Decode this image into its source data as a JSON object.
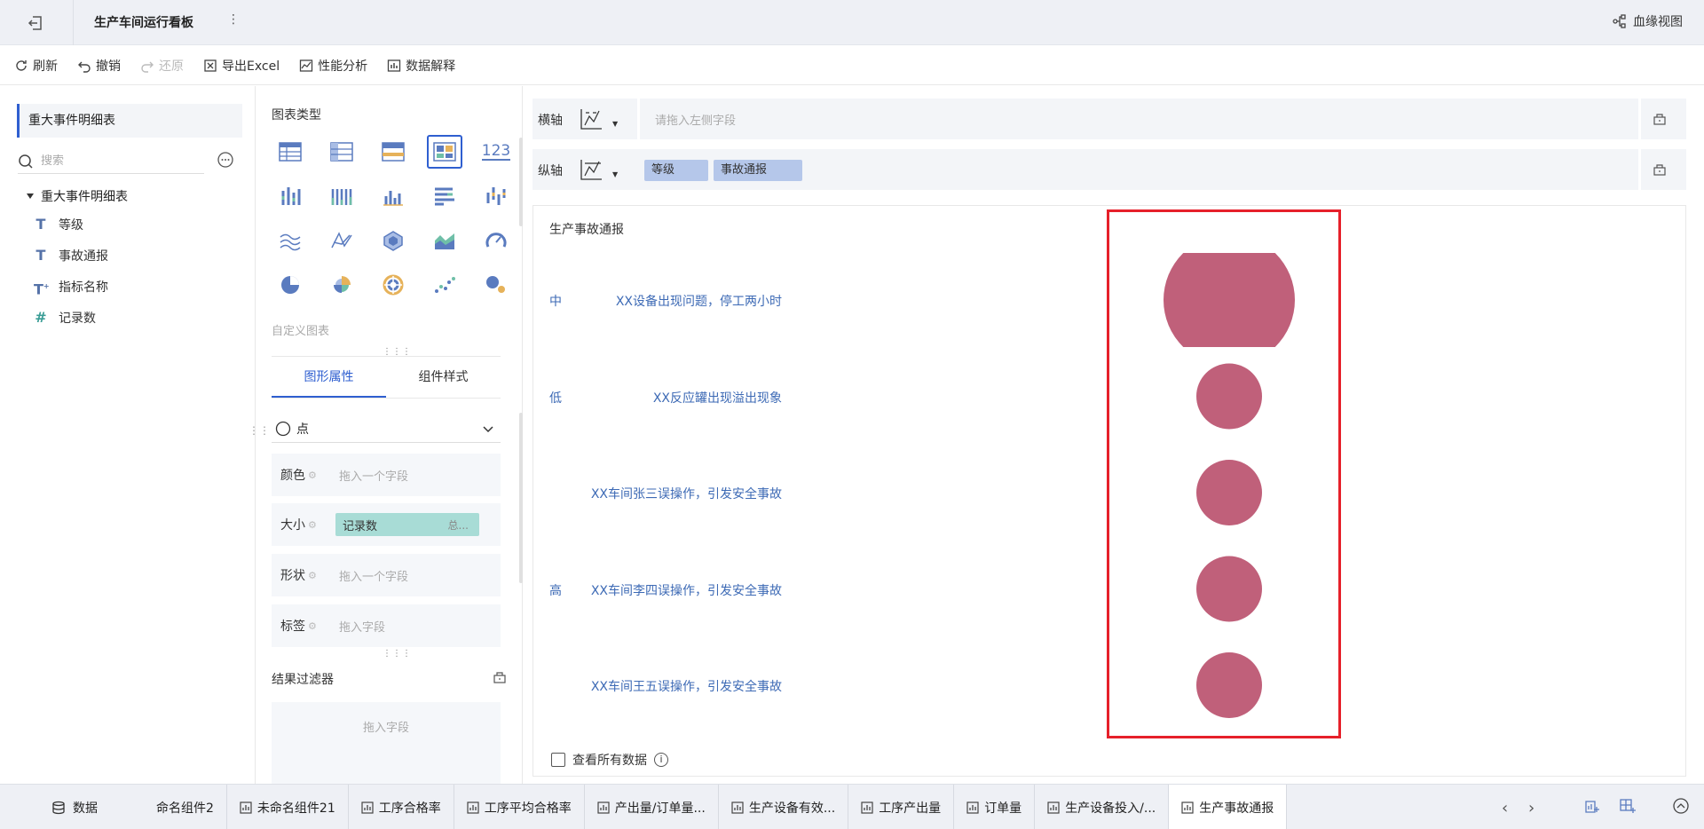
{
  "header": {
    "title": "生产车间运行看板",
    "more": "⋮",
    "lineage_label": "血缘视图"
  },
  "toolbar": {
    "refresh": "刷新",
    "undo": "撤销",
    "redo": "还原",
    "export_excel": "导出Excel",
    "performance": "性能分析",
    "data_explain": "数据解释"
  },
  "left_panel": {
    "dataset_title": "重大事件明细表",
    "search_placeholder": "搜索",
    "tree_root": "重大事件明细表",
    "fields": [
      {
        "name": "等级",
        "type": "text"
      },
      {
        "name": "事故通报",
        "type": "text"
      },
      {
        "name": "指标名称",
        "type": "text-calc"
      },
      {
        "name": "记录数",
        "type": "number"
      }
    ]
  },
  "config_panel": {
    "chart_type_label": "图表类型",
    "custom_chart_label": "自定义图表",
    "number_chart_text": "123",
    "tabs": {
      "shape_props": "图形属性",
      "component_style": "组件样式"
    },
    "mark_type": "点",
    "props": {
      "color_label": "颜色",
      "color_hint": "拖入一个字段",
      "size_label": "大小",
      "size_field": "记录数",
      "size_agg": "总...",
      "shape_label": "形状",
      "shape_hint": "拖入一个字段",
      "label_label": "标签",
      "label_hint": "拖入字段"
    },
    "filter_label": "结果过滤器",
    "filter_hint": "拖入字段"
  },
  "axes": {
    "x_label": "横轴",
    "x_hint": "请拖入左侧字段",
    "y_label": "纵轴",
    "y_fields": [
      "等级",
      "事故通报"
    ]
  },
  "chart": {
    "view_all_label": "查看所有数据",
    "info_glyph": "i"
  },
  "chart_data": {
    "type": "scatter",
    "title": "生产事故通报",
    "y_categories": [
      {
        "level": "中",
        "report": "XX设备出现问题，停工两小时",
        "count": 2
      },
      {
        "level": "低",
        "report": "XX反应罐出现溢出现象",
        "count": 1
      },
      {
        "level": "",
        "report": "XX车间张三误操作，引发安全事故",
        "count": 1
      },
      {
        "level": "高",
        "report": "XX车间李四误操作，引发安全事故",
        "count": 1
      },
      {
        "level": "",
        "report": "XX车间王五误操作，引发安全事故",
        "count": 1
      }
    ],
    "size_field": "记录数",
    "mark_color": "#c0607a",
    "highlight_color": "#e6202a"
  },
  "bottom_bar": {
    "data_label": "数据",
    "tabs": [
      "命名组件2",
      "未命名组件21",
      "工序合格率",
      "工序平均合格率",
      "产出量/订单量...",
      "生产设备有效...",
      "工序产出量",
      "订单量",
      "生产设备投入/...",
      "生产事故通报"
    ],
    "active_tab": "生产事故通报"
  }
}
